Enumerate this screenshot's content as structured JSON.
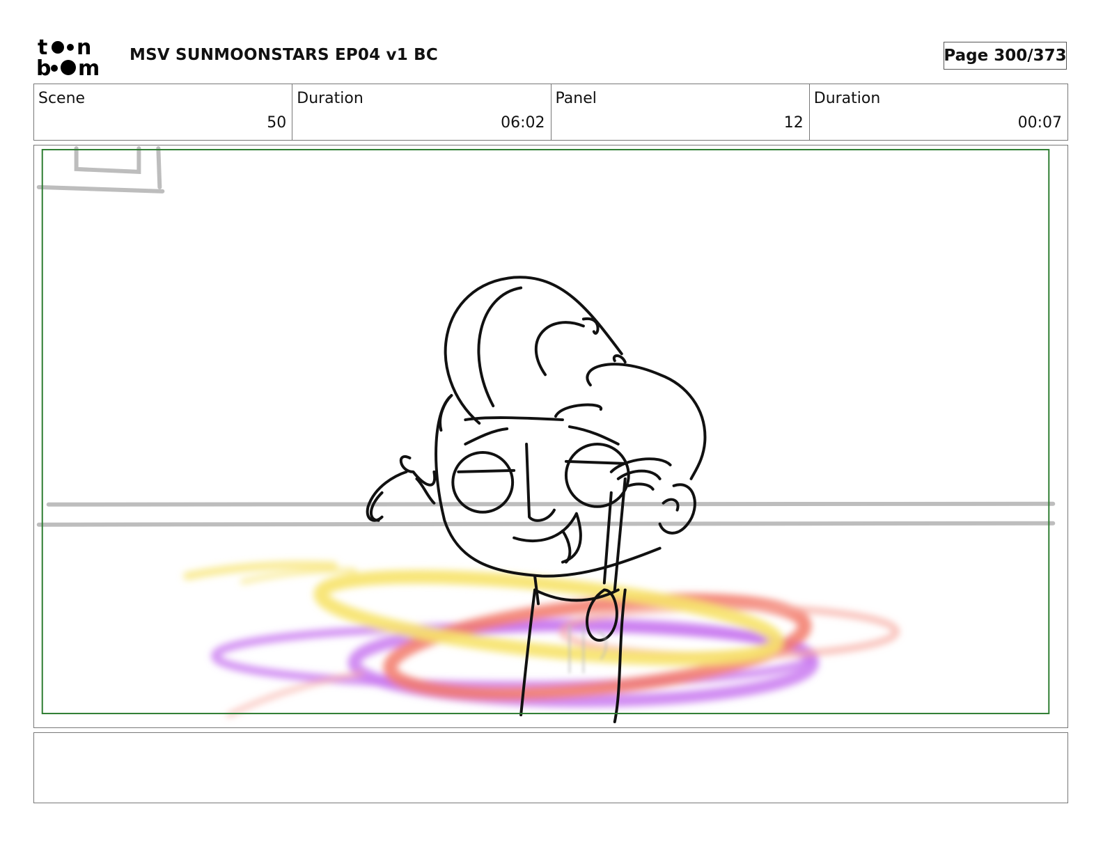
{
  "header": {
    "logo_text": "toonboom",
    "title": "MSV SUNMOONSTARS EP04 v1 BC",
    "page_label": "Page 300/373"
  },
  "info": [
    {
      "label": "Scene",
      "value": "50"
    },
    {
      "label": "Duration",
      "value": "06:02"
    },
    {
      "label": "Panel",
      "value": "12"
    },
    {
      "label": "Duration",
      "value": "00:07"
    }
  ],
  "panel": {
    "safe_frame_color": "#2e7d32",
    "description": "Rough storyboard sketch: smiling cartoon woman with pompadour hair, holding a phone, rainbow swirl rings around her"
  },
  "swirl_colors": {
    "yellow": "#f7e36b",
    "red": "#f27a6a",
    "purple": "#c979f0"
  },
  "notes": ""
}
